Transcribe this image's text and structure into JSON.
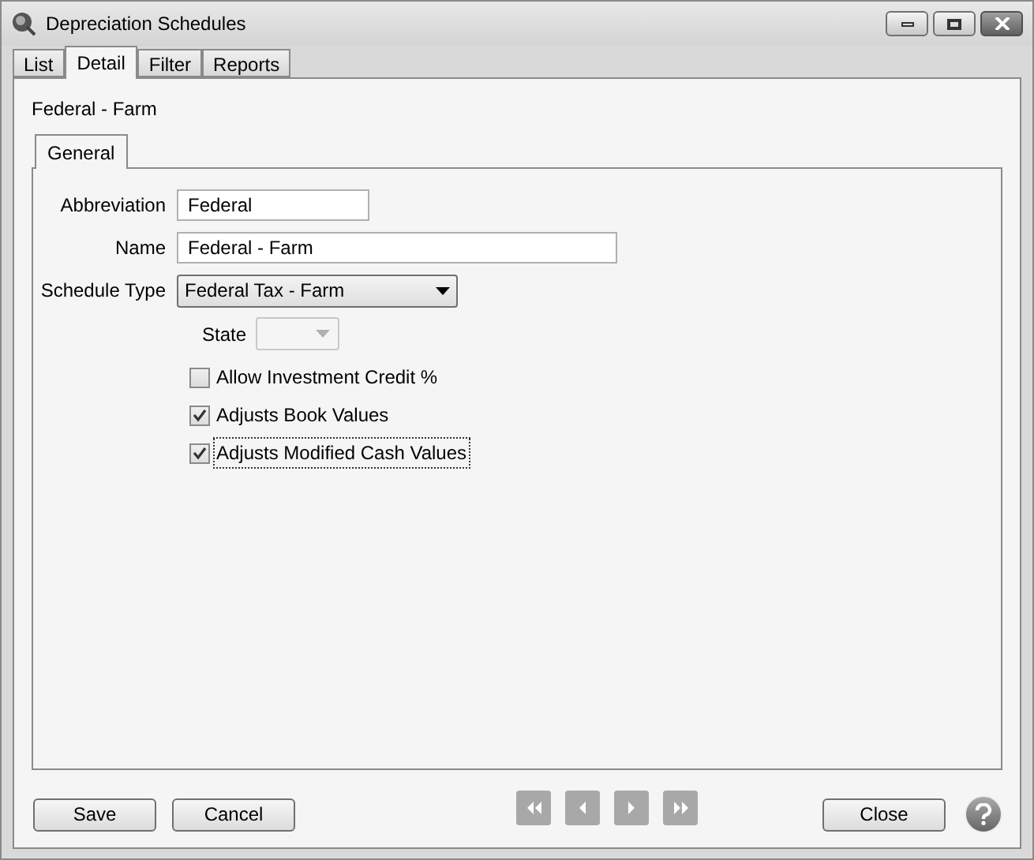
{
  "window": {
    "title": "Depreciation Schedules"
  },
  "tabs": [
    {
      "label": "List",
      "selected": false
    },
    {
      "label": "Detail",
      "selected": true
    },
    {
      "label": "Filter",
      "selected": false
    },
    {
      "label": "Reports",
      "selected": false
    }
  ],
  "record_title": "Federal - Farm",
  "inner_tabs": [
    {
      "label": "General",
      "selected": true
    }
  ],
  "fields": [
    {
      "label": "Abbreviation",
      "value": "Federal",
      "kind": "short"
    },
    {
      "label": "Name",
      "value": "Federal - Farm",
      "kind": "long"
    },
    {
      "label": "Schedule Type",
      "value": "Federal Tax - Farm",
      "kind": "dropdown"
    }
  ],
  "state_field": {
    "label": "State",
    "disabled": true
  },
  "checkboxes": [
    {
      "label": "Allow Investment Credit %",
      "checked": false,
      "focused": false
    },
    {
      "label": "Adjusts Book Values",
      "checked": true,
      "focused": false
    },
    {
      "label": "Adjusts Modified Cash Values",
      "checked": true,
      "focused": true
    }
  ],
  "buttons_left": [
    "Save",
    "Cancel"
  ],
  "nav_buttons": [
    {
      "kind": "first",
      "disabled": true
    },
    {
      "kind": "prev",
      "disabled": true
    },
    {
      "kind": "next",
      "disabled": true
    },
    {
      "kind": "last",
      "disabled": true
    }
  ],
  "buttons_right": [
    "Close"
  ]
}
